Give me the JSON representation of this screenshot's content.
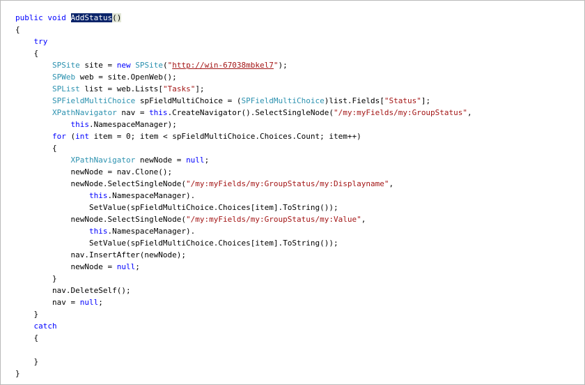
{
  "code": {
    "lines": [
      [
        {
          "t": "kw",
          "v": "public"
        },
        {
          "t": "",
          "v": " "
        },
        {
          "t": "kw",
          "v": "void"
        },
        {
          "t": "",
          "v": " "
        },
        {
          "t": "hl",
          "v": "AddStatus"
        },
        {
          "t": "paren-hl",
          "v": "()"
        }
      ],
      [
        {
          "t": "",
          "v": "{"
        }
      ],
      [
        {
          "t": "",
          "v": "    "
        },
        {
          "t": "kw",
          "v": "try"
        }
      ],
      [
        {
          "t": "",
          "v": "    {"
        }
      ],
      [
        {
          "t": "",
          "v": "        "
        },
        {
          "t": "ty",
          "v": "SPSite"
        },
        {
          "t": "",
          "v": " site = "
        },
        {
          "t": "kw",
          "v": "new"
        },
        {
          "t": "",
          "v": " "
        },
        {
          "t": "ty",
          "v": "SPSite"
        },
        {
          "t": "",
          "v": "("
        },
        {
          "t": "st",
          "v": "\""
        },
        {
          "t": "url",
          "v": "http://win-67038mbkel7"
        },
        {
          "t": "st",
          "v": "\""
        },
        {
          "t": "",
          "v": ");"
        }
      ],
      [
        {
          "t": "",
          "v": "        "
        },
        {
          "t": "ty",
          "v": "SPWeb"
        },
        {
          "t": "",
          "v": " web = site.OpenWeb();"
        }
      ],
      [
        {
          "t": "",
          "v": "        "
        },
        {
          "t": "ty",
          "v": "SPList"
        },
        {
          "t": "",
          "v": " list = web.Lists["
        },
        {
          "t": "st",
          "v": "\"Tasks\""
        },
        {
          "t": "",
          "v": "];"
        }
      ],
      [
        {
          "t": "",
          "v": "        "
        },
        {
          "t": "ty",
          "v": "SPFieldMultiChoice"
        },
        {
          "t": "",
          "v": " spFieldMultiChoice = ("
        },
        {
          "t": "ty",
          "v": "SPFieldMultiChoice"
        },
        {
          "t": "",
          "v": ")list.Fields["
        },
        {
          "t": "st",
          "v": "\"Status\""
        },
        {
          "t": "",
          "v": "];"
        }
      ],
      [
        {
          "t": "",
          "v": "        "
        },
        {
          "t": "ty",
          "v": "XPathNavigator"
        },
        {
          "t": "",
          "v": " nav = "
        },
        {
          "t": "kw",
          "v": "this"
        },
        {
          "t": "",
          "v": ".CreateNavigator().SelectSingleNode("
        },
        {
          "t": "st",
          "v": "\"/my:myFields/my:GroupStatus\""
        },
        {
          "t": "",
          "v": ","
        }
      ],
      [
        {
          "t": "",
          "v": "            "
        },
        {
          "t": "kw",
          "v": "this"
        },
        {
          "t": "",
          "v": ".NamespaceManager);"
        }
      ],
      [
        {
          "t": "",
          "v": "        "
        },
        {
          "t": "kw",
          "v": "for"
        },
        {
          "t": "",
          "v": " ("
        },
        {
          "t": "kw",
          "v": "int"
        },
        {
          "t": "",
          "v": " item = 0; item < spFieldMultiChoice.Choices.Count; item++)"
        }
      ],
      [
        {
          "t": "",
          "v": "        {"
        }
      ],
      [
        {
          "t": "",
          "v": "            "
        },
        {
          "t": "ty",
          "v": "XPathNavigator"
        },
        {
          "t": "",
          "v": " newNode = "
        },
        {
          "t": "kw",
          "v": "null"
        },
        {
          "t": "",
          "v": ";"
        }
      ],
      [
        {
          "t": "",
          "v": "            newNode = nav.Clone();"
        }
      ],
      [
        {
          "t": "",
          "v": "            newNode.SelectSingleNode("
        },
        {
          "t": "st",
          "v": "\"/my:myFields/my:GroupStatus/my:Displayname\""
        },
        {
          "t": "",
          "v": ","
        }
      ],
      [
        {
          "t": "",
          "v": "                "
        },
        {
          "t": "kw",
          "v": "this"
        },
        {
          "t": "",
          "v": ".NamespaceManager)."
        }
      ],
      [
        {
          "t": "",
          "v": "                SetValue(spFieldMultiChoice.Choices[item].ToString());"
        }
      ],
      [
        {
          "t": "",
          "v": "            newNode.SelectSingleNode("
        },
        {
          "t": "st",
          "v": "\"/my:myFields/my:GroupStatus/my:Value\""
        },
        {
          "t": "",
          "v": ","
        }
      ],
      [
        {
          "t": "",
          "v": "                "
        },
        {
          "t": "kw",
          "v": "this"
        },
        {
          "t": "",
          "v": ".NamespaceManager)."
        }
      ],
      [
        {
          "t": "",
          "v": "                SetValue(spFieldMultiChoice.Choices[item].ToString());"
        }
      ],
      [
        {
          "t": "",
          "v": "            nav.InsertAfter(newNode);"
        }
      ],
      [
        {
          "t": "",
          "v": "            newNode = "
        },
        {
          "t": "kw",
          "v": "null"
        },
        {
          "t": "",
          "v": ";"
        }
      ],
      [
        {
          "t": "",
          "v": "        }"
        }
      ],
      [
        {
          "t": "",
          "v": "        nav.DeleteSelf();"
        }
      ],
      [
        {
          "t": "",
          "v": "        nav = "
        },
        {
          "t": "kw",
          "v": "null"
        },
        {
          "t": "",
          "v": ";"
        }
      ],
      [
        {
          "t": "",
          "v": "    }"
        }
      ],
      [
        {
          "t": "",
          "v": "    "
        },
        {
          "t": "kw",
          "v": "catch"
        }
      ],
      [
        {
          "t": "",
          "v": "    {"
        }
      ],
      [
        {
          "t": "",
          "v": ""
        }
      ],
      [
        {
          "t": "",
          "v": "    }"
        }
      ],
      [
        {
          "t": "",
          "v": "}"
        }
      ]
    ]
  },
  "colors": {
    "keyword": "#0000ff",
    "type": "#2b91af",
    "string": "#a31515",
    "selection_background": "#0a246a",
    "border": "#b9b9b9"
  }
}
